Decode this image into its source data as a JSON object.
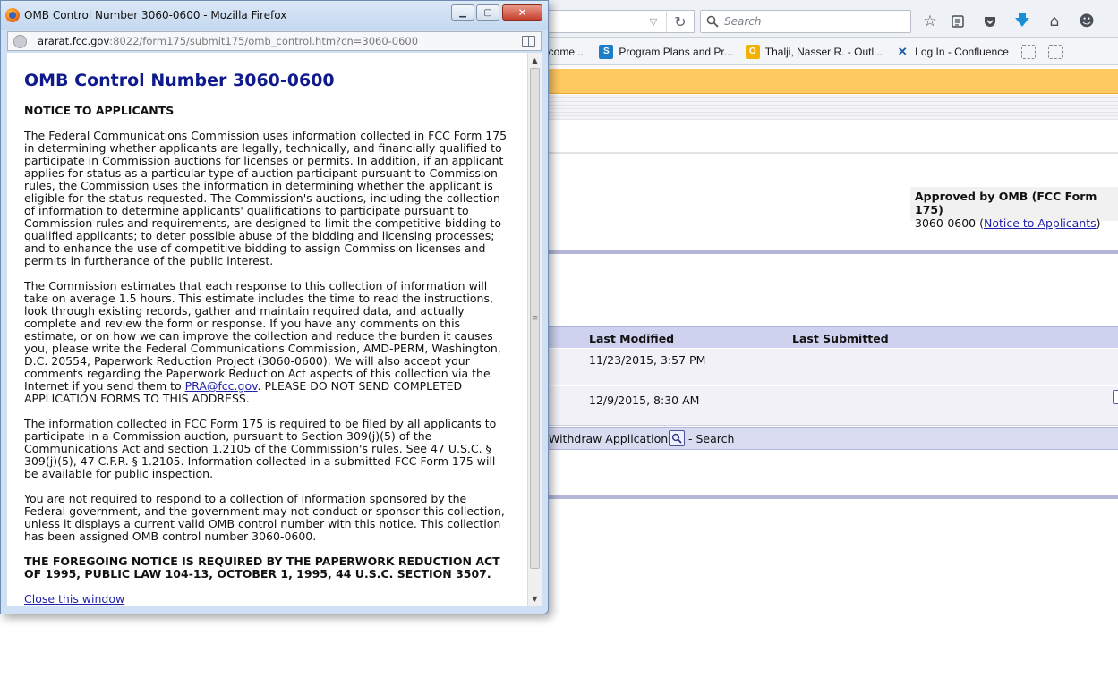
{
  "browser": {
    "search_placeholder": "Search",
    "bookmarks": [
      {
        "label": "lcome ...",
        "icon": "page-icon"
      },
      {
        "label": "Program Plans and Pr...",
        "icon": "sharepoint-icon"
      },
      {
        "label": "Thalji, Nasser R. - Outl...",
        "icon": "outlook-icon"
      },
      {
        "label": "Log In - Confluence",
        "icon": "confluence-icon"
      }
    ]
  },
  "page": {
    "approved_title": "Approved by OMB (FCC Form 175)",
    "omb_number": "3060-0600",
    "notice_link": "Notice to Applicants",
    "table_headers": {
      "last_modified": "Last Modified",
      "last_submitted": "Last Submitted"
    },
    "rows": [
      {
        "last_modified": "11/23/2015, 3:57 PM",
        "last_submitted": ""
      },
      {
        "last_modified": "12/9/2015, 8:30 AM",
        "last_submitted": ""
      }
    ],
    "actions": {
      "withdraw": "Withdraw Application",
      "search": "- Search"
    }
  },
  "popup": {
    "window_title": "OMB Control Number 3060-0600 - Mozilla Firefox",
    "url_host": "ararat.fcc.gov",
    "url_path": ":8022/form175/submit175/omb_control.htm?cn=3060-0600",
    "heading": "OMB Control Number 3060-0600",
    "notice_title": "NOTICE TO APPLICANTS",
    "para1": "The Federal Communications Commission uses information collected in FCC Form 175 in determining whether applicants are legally, technically, and financially qualified to participate in Commission auctions for licenses or permits. In addition, if an applicant applies for status as a particular type of auction participant pursuant to Commission rules, the Commission uses the information in determining whether the applicant is eligible for the status requested. The Commission's auctions, including the collection of information to determine applicants' qualifications to participate pursuant to Commission rules and requirements, are designed to limit the competitive bidding to qualified applicants; to deter possible abuse of the bidding and licensing processes; and to enhance the use of competitive bidding to assign Commission licenses and permits in furtherance of the public interest.",
    "para2_before_link": "The Commission estimates that each response to this collection of information will take on average 1.5 hours. This estimate includes the time to read the instructions, look through existing records, gather and maintain required data, and actually complete and review the form or response. If you have any comments on this estimate, or on how we can improve the collection and reduce the burden it causes you, please write the Federal Communications Commission, AMD-PERM, Washington, D.C. 20554, Paperwork Reduction Project (3060-0600). We will also accept your comments regarding the Paperwork Reduction Act aspects of this collection via the Internet if you send them to ",
    "para2_link": "PRA@fcc.gov",
    "para2_after_link": ". PLEASE DO NOT SEND COMPLETED APPLICATION FORMS TO THIS ADDRESS.",
    "para3": "The information collected in FCC Form 175 is required to be filed by all applicants to participate in a Commission auction, pursuant to Section 309(j)(5) of the Communications Act and section 1.2105 of the Commission's rules. See 47 U.S.C. § 309(j)(5), 47 C.F.R. § 1.2105. Information collected in a submitted FCC Form 175 will be available for public inspection.",
    "para4": "You are not required to respond to a collection of information sponsored by the Federal government, and the government may not conduct or sponsor this collection, unless it displays a current valid OMB control number with this notice. This collection has been assigned OMB control number 3060-0600.",
    "bold_notice": "THE FOREGOING NOTICE IS REQUIRED BY THE PAPERWORK REDUCTION ACT OF 1995, PUBLIC LAW 104-13, OCTOBER 1, 1995, 44 U.S.C. SECTION 3507.",
    "close_link": "Close this window"
  },
  "colors": {
    "heading_blue": "#0f1a8c",
    "link_blue": "#1f1fa8",
    "orange_bar": "#ffc961",
    "table_header": "#cfd2ef"
  }
}
